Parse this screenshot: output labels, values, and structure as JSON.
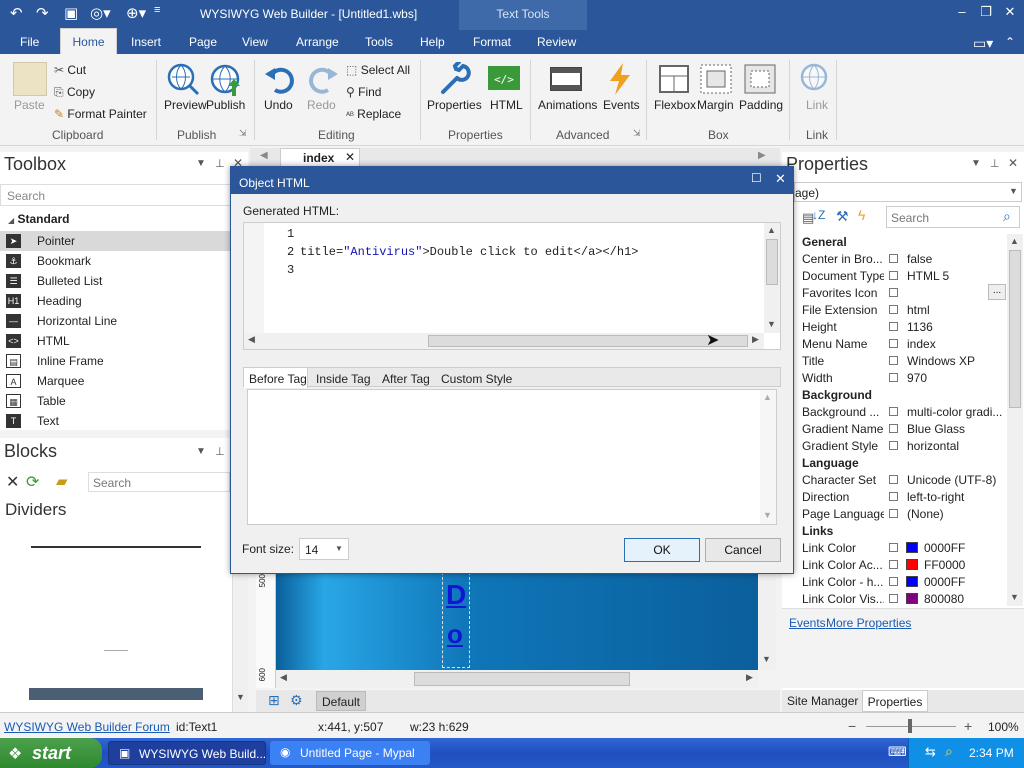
{
  "app": {
    "title": "WYSIWYG Web Builder - [Untitled1.wbs]",
    "context_tab": "Text Tools"
  },
  "menu": {
    "file": "File",
    "home": "Home",
    "insert": "Insert",
    "page": "Page",
    "view": "View",
    "arrange": "Arrange",
    "tools": "Tools",
    "help": "Help",
    "format": "Format",
    "review": "Review"
  },
  "ribbon": {
    "clipboard": {
      "paste": "Paste",
      "cut": "Cut",
      "copy": "Copy",
      "format_painter": "Format Painter",
      "group": "Clipboard"
    },
    "publish": {
      "preview": "Preview",
      "publish": "Publish",
      "group": "Publish"
    },
    "editing": {
      "undo": "Undo",
      "redo": "Redo",
      "select_all": "Select All",
      "find": "Find",
      "replace": "Replace",
      "group": "Editing"
    },
    "properties": {
      "properties": "Properties",
      "html": "HTML",
      "group": "Properties"
    },
    "advanced": {
      "animations": "Animations",
      "events": "Events",
      "group": "Advanced"
    },
    "box": {
      "flexbox": "Flexbox",
      "margin": "Margin",
      "padding": "Padding",
      "group": "Box"
    },
    "link": {
      "link": "Link",
      "group": "Link"
    }
  },
  "toolbox": {
    "title": "Toolbox",
    "search_placeholder": "Search",
    "category": "Standard",
    "items": [
      "Pointer",
      "Bookmark",
      "Bulleted List",
      "Heading",
      "Horizontal Line",
      "HTML",
      "Inline Frame",
      "Marquee",
      "Table",
      "Text"
    ]
  },
  "blocks": {
    "title": "Blocks",
    "search_placeholder": "Search",
    "category": "Dividers"
  },
  "document_tab": {
    "label": "index"
  },
  "canvas": {
    "text": "D",
    "text2": "o",
    "ruler_500": "500",
    "ruler_600": "600",
    "default_label": "Default"
  },
  "dialog": {
    "title": "Object HTML",
    "generated_label": "Generated HTML:",
    "line_numbers": [
      "1",
      "2",
      "3"
    ],
    "code_line2_prefix": "title=",
    "code_line2_string": "\"Antivirus\"",
    "code_line2_suffix": ">Double click to edit</a></h1>",
    "tabs": [
      "Before Tag",
      "Inside Tag",
      "After Tag",
      "Custom Style"
    ],
    "font_size_label": "Font size:",
    "font_size_value": "14",
    "ok": "OK",
    "cancel": "Cancel"
  },
  "properties": {
    "title": "Properties",
    "selector_value": "age)",
    "search_placeholder": "Search",
    "general": {
      "label": "General",
      "rows": [
        [
          "Center in Bro...",
          "false"
        ],
        [
          "Document Type",
          "HTML 5"
        ],
        [
          "Favorites Icon",
          ""
        ],
        [
          "File Extension",
          "html"
        ],
        [
          "Height",
          "1136"
        ],
        [
          "Menu Name",
          "index"
        ],
        [
          "Title",
          "Windows XP"
        ],
        [
          "Width",
          "970"
        ]
      ]
    },
    "background": {
      "label": "Background",
      "rows": [
        [
          "Background ...",
          "multi-color gradi..."
        ],
        [
          "Gradient Name",
          "Blue Glass"
        ],
        [
          "Gradient Style",
          "horizontal"
        ]
      ]
    },
    "language": {
      "label": "Language",
      "rows": [
        [
          "Character Set",
          "Unicode (UTF-8)"
        ],
        [
          "Direction",
          "left-to-right"
        ],
        [
          "Page Language",
          "(None)"
        ]
      ]
    },
    "links": {
      "label": "Links",
      "rows": [
        [
          "Link Color",
          "0000FF",
          "#0000ff"
        ],
        [
          "Link Color Ac...",
          "FF0000",
          "#ff0000"
        ],
        [
          "Link Color - h...",
          "0000FF",
          "#0000ff"
        ],
        [
          "Link Color Vis...",
          "800080",
          "#800080"
        ]
      ]
    },
    "events_link": "Events",
    "more_link": "More Properties",
    "ellipsis": "..."
  },
  "bottom_tabs": {
    "site_manager": "Site Manager",
    "properties": "Properties"
  },
  "status": {
    "forum": "WYSIWYG Web Builder Forum",
    "id": "id:Text1",
    "coords": "x:441, y:507",
    "size": "w:23 h:629",
    "zoom": "100%"
  },
  "taskbar": {
    "start": "start",
    "task1": "WYSIWYG Web Build...",
    "task2": "Untitled Page - Mypal",
    "time": "2:34 PM"
  }
}
